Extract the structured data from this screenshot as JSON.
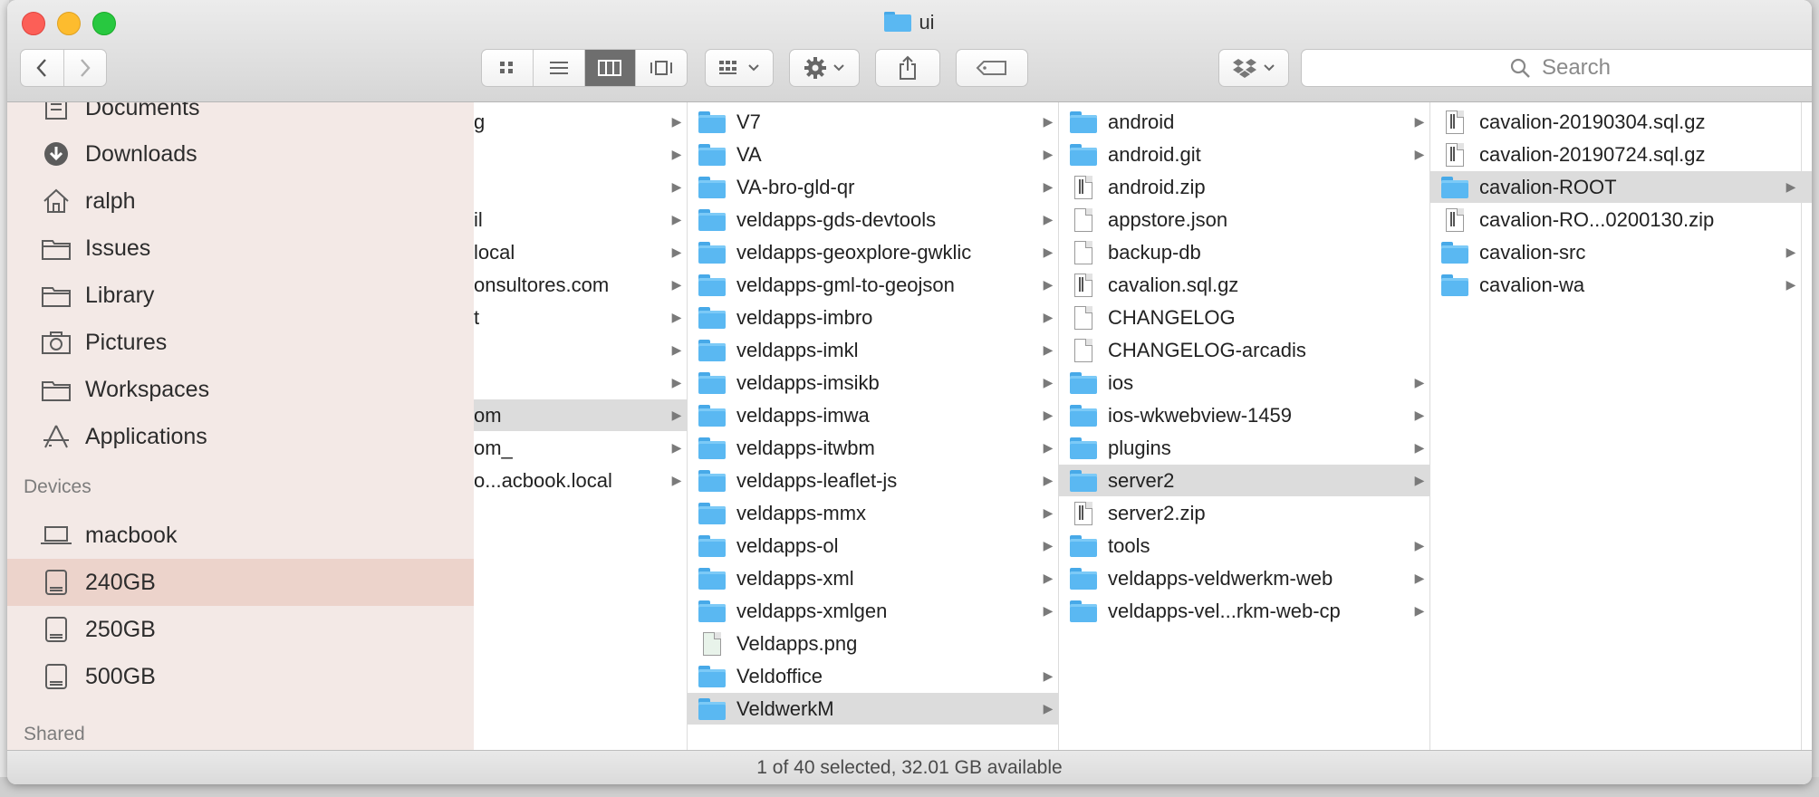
{
  "window": {
    "title": "ui"
  },
  "toolbar": {
    "search_placeholder": "Search"
  },
  "sidebar": {
    "favorites": [
      "Documents",
      "Downloads",
      "ralph",
      "Issues",
      "Library",
      "Pictures",
      "Workspaces",
      "Applications"
    ],
    "devices_header": "Devices",
    "devices": [
      "macbook",
      "240GB",
      "250GB",
      "500GB"
    ],
    "selected_device": "240GB",
    "shared_header": "Shared"
  },
  "column1": [
    {
      "name": "g",
      "arrow": true
    },
    {
      "name": "",
      "arrow": true
    },
    {
      "name": "",
      "arrow": true
    },
    {
      "name": "il",
      "arrow": true
    },
    {
      "name": "local",
      "arrow": true
    },
    {
      "name": "onsultores.com",
      "arrow": true
    },
    {
      "name": "t",
      "arrow": true
    },
    {
      "name": "",
      "arrow": true
    },
    {
      "name": "",
      "arrow": true
    },
    {
      "name": "om",
      "arrow": true,
      "selected": true
    },
    {
      "name": "om_",
      "arrow": true
    },
    {
      "name": "o...acbook.local",
      "arrow": true
    }
  ],
  "column2": [
    {
      "name": "V7",
      "type": "folder",
      "arrow": true
    },
    {
      "name": "VA",
      "type": "folder",
      "arrow": true
    },
    {
      "name": "VA-bro-gld-qr",
      "type": "folder",
      "arrow": true
    },
    {
      "name": "veldapps-gds-devtools",
      "type": "folder",
      "arrow": true
    },
    {
      "name": "veldapps-geoxplore-gwklic",
      "type": "folder",
      "arrow": true
    },
    {
      "name": "veldapps-gml-to-geojson",
      "type": "folder",
      "arrow": true
    },
    {
      "name": "veldapps-imbro",
      "type": "folder",
      "arrow": true
    },
    {
      "name": "veldapps-imkl",
      "type": "folder",
      "arrow": true
    },
    {
      "name": "veldapps-imsikb",
      "type": "folder",
      "arrow": true
    },
    {
      "name": "veldapps-imwa",
      "type": "folder",
      "arrow": true
    },
    {
      "name": "veldapps-itwbm",
      "type": "folder",
      "arrow": true
    },
    {
      "name": "veldapps-leaflet-js",
      "type": "folder",
      "arrow": true
    },
    {
      "name": "veldapps-mmx",
      "type": "folder",
      "arrow": true
    },
    {
      "name": "veldapps-ol",
      "type": "folder",
      "arrow": true
    },
    {
      "name": "veldapps-xml",
      "type": "folder",
      "arrow": true
    },
    {
      "name": "veldapps-xmlgen",
      "type": "folder",
      "arrow": true
    },
    {
      "name": "Veldapps.png",
      "type": "image",
      "arrow": false
    },
    {
      "name": "Veldoffice",
      "type": "folder",
      "arrow": true
    },
    {
      "name": "VeldwerkM",
      "type": "folder",
      "arrow": true,
      "selected": true
    }
  ],
  "column3": [
    {
      "name": "android",
      "type": "folder",
      "arrow": true
    },
    {
      "name": "android.git",
      "type": "folder",
      "arrow": true
    },
    {
      "name": "android.zip",
      "type": "archive",
      "arrow": false
    },
    {
      "name": "appstore.json",
      "type": "doc",
      "arrow": false
    },
    {
      "name": "backup-db",
      "type": "doc",
      "arrow": false
    },
    {
      "name": "cavalion.sql.gz",
      "type": "archive",
      "arrow": false
    },
    {
      "name": "CHANGELOG",
      "type": "doc",
      "arrow": false
    },
    {
      "name": "CHANGELOG-arcadis",
      "type": "doc",
      "arrow": false
    },
    {
      "name": "ios",
      "type": "folder",
      "arrow": true
    },
    {
      "name": "ios-wkwebview-1459",
      "type": "folder",
      "arrow": true
    },
    {
      "name": "plugins",
      "type": "folder",
      "arrow": true
    },
    {
      "name": "server2",
      "type": "folder",
      "arrow": true,
      "selected": true
    },
    {
      "name": "server2.zip",
      "type": "archive",
      "arrow": false
    },
    {
      "name": "tools",
      "type": "folder",
      "arrow": true
    },
    {
      "name": "veldapps-veldwerkm-web",
      "type": "folder",
      "arrow": true
    },
    {
      "name": "veldapps-vel...rkm-web-cp",
      "type": "folder",
      "arrow": true
    }
  ],
  "column4": [
    {
      "name": "cavalion-20190304.sql.gz",
      "type": "archive",
      "arrow": false
    },
    {
      "name": "cavalion-20190724.sql.gz",
      "type": "archive",
      "arrow": false
    },
    {
      "name": "cavalion-ROOT",
      "type": "folder",
      "arrow": true,
      "selected": true
    },
    {
      "name": "cavalion-RO...0200130.zip",
      "type": "archive",
      "arrow": false
    },
    {
      "name": "cavalion-src",
      "type": "folder",
      "arrow": true
    },
    {
      "name": "cavalion-wa",
      "type": "folder",
      "arrow": true
    }
  ],
  "column5": [
    {
      "type": "folder"
    },
    {
      "type": "folder"
    },
    {
      "type": "folder",
      "selected": true
    }
  ],
  "status": {
    "text": "1 of 40 selected, 32.01 GB available"
  }
}
